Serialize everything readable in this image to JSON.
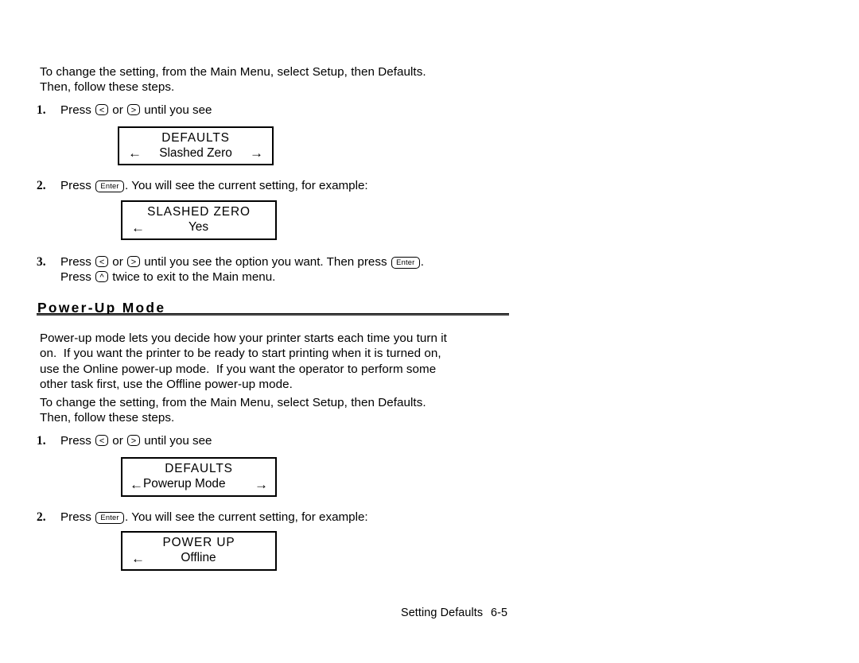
{
  "document": {
    "section_a": {
      "intro": "To change the setting, from the Main Menu, select Setup, then Defaults.\nThen, follow these steps.",
      "steps": [
        {
          "num": "1.",
          "pre": "Press ",
          "key1": "<",
          "mid": " or ",
          "key2": ">",
          "post": " until you see"
        },
        {
          "num": "2.",
          "pre": "Press ",
          "key1": "Enter",
          "post": ".  You will see the current setting, for example:"
        },
        {
          "num": "3.",
          "line1_pre": "Press ",
          "line1_key1": "<",
          "line1_mid": " or ",
          "line1_key2": ">",
          "line1_post": " until you see the option you want.  Then press ",
          "line1_key3": "Enter",
          "line1_end": ".",
          "line2_pre": "Press ",
          "line2_key": "^",
          "line2_post": " twice to exit to the Main menu."
        }
      ],
      "display1": {
        "line1": "DEFAULTS",
        "left_arrow": "←",
        "label": "Slashed Zero",
        "right_arrow": "→"
      },
      "display2": {
        "line1": "SLASHED ZERO",
        "left_arrow": "←",
        "value": "Yes"
      }
    },
    "section_b": {
      "heading": "Power-Up Mode",
      "body": "Power-up mode lets you decide how your printer starts each time you turn it\non.  If you want the printer to be ready to start printing when it is turned on,\nuse the Online power-up mode.  If you want the operator to perform some\nother task first, use the Offline power-up mode.",
      "intro": "To change the setting, from the Main Menu, select Setup, then Defaults.\nThen, follow these steps.",
      "steps": [
        {
          "num": "1.",
          "pre": "Press ",
          "key1": "<",
          "mid": " or ",
          "key2": ">",
          "post": " until you see"
        },
        {
          "num": "2.",
          "pre": "Press ",
          "key1": "Enter",
          "post": ".  You will see the current setting, for example:"
        }
      ],
      "display3": {
        "line1": "DEFAULTS",
        "left_arrow": "←",
        "label": "Powerup Mode",
        "right_arrow": "→"
      },
      "display4": {
        "line1": "POWER UP",
        "left_arrow": "←",
        "value": "Offline"
      }
    },
    "footer": {
      "title": "Setting Defaults",
      "page": "6-5"
    }
  }
}
